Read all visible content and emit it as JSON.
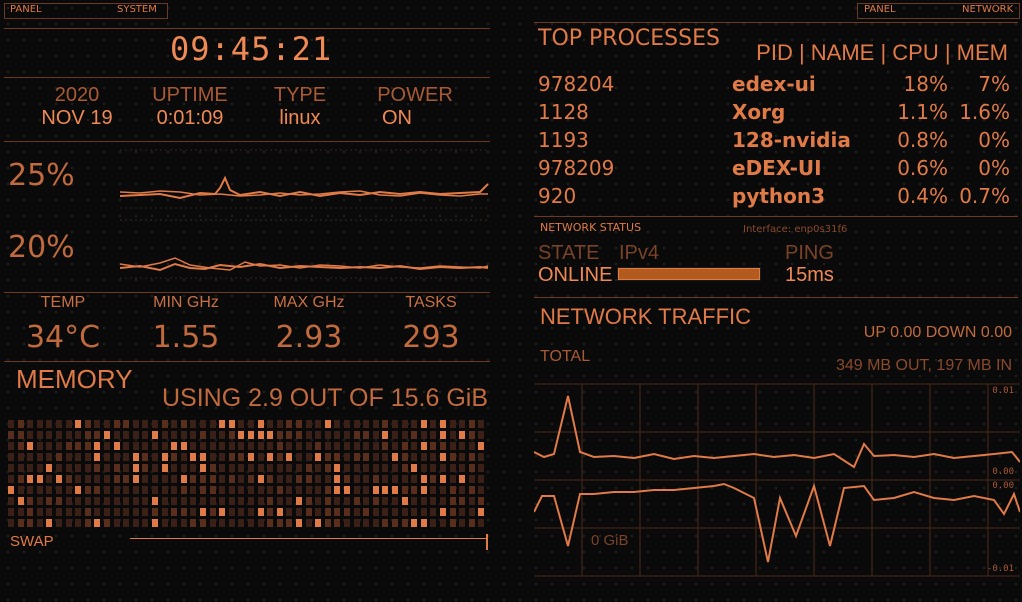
{
  "left_panel": {
    "tab_left": "PANEL",
    "tab_right": "SYSTEM",
    "clock": "09:45:21",
    "clock_parts": [
      "09",
      ":",
      "45",
      ":",
      "21"
    ],
    "sysinfo": [
      {
        "label": "2020",
        "value": "NOV 19"
      },
      {
        "label": "UPTIME",
        "value": "0:01:09"
      },
      {
        "label": "TYPE",
        "value": "linux"
      },
      {
        "label": "POWER",
        "value": "ON"
      }
    ],
    "cpu_graphs": [
      {
        "percent": "25%"
      },
      {
        "percent": "20%"
      }
    ],
    "cpu_stats": [
      {
        "label": "TEMP",
        "value": "34°C"
      },
      {
        "label": "MIN GHz",
        "value": "1.55"
      },
      {
        "label": "MAX GHz",
        "value": "2.93"
      },
      {
        "label": "TASKS",
        "value": "293"
      }
    ],
    "memory": {
      "title": "MEMORY",
      "usage": "USING 2.9 OUT OF 15.6 GiB",
      "swap_label": "SWAP"
    }
  },
  "right_panel": {
    "tab_left": "PANEL",
    "tab_right": "NETWORK",
    "top_processes": {
      "title": "TOP PROCESSES",
      "header": "PID | NAME | CPU | MEM",
      "rows": [
        {
          "pid": "978204",
          "name": "edex-ui",
          "cpu": "18%",
          "mem": "7%"
        },
        {
          "pid": "1128",
          "name": "Xorg",
          "cpu": "1.1%",
          "mem": "1.6%"
        },
        {
          "pid": "1193",
          "name": "128-nvidia",
          "cpu": "0.8%",
          "mem": "0%"
        },
        {
          "pid": "978209",
          "name": "eDEX-UI",
          "cpu": "0.6%",
          "mem": "0%"
        },
        {
          "pid": "920",
          "name": "python3",
          "cpu": "0.4%",
          "mem": "0.7%"
        }
      ]
    },
    "network_status": {
      "title": "NETWORK STATUS",
      "interface": "Interface: enp0s31f6",
      "state_label": "STATE",
      "state_value": "ONLINE",
      "ipv4_label": "IPv4",
      "ping_label": "PING",
      "ping_value": "15ms"
    },
    "network_traffic": {
      "title": "NETWORK TRAFFIC",
      "rates": "UP 0.00 DOWN 0.00",
      "total_label": "TOTAL",
      "total_value": "349 MB OUT, 197 MB IN",
      "axis_top_max": "0.01",
      "axis_top_min": "0.00",
      "axis_bottom_max": "0.00",
      "axis_bottom_min": "-0.01",
      "overlay": "0 GiB"
    }
  },
  "colors": {
    "accent": "#e07a47",
    "dim": "#6a3a24",
    "background": "#0a0a0a",
    "bar_fill": "#b35a1e"
  }
}
